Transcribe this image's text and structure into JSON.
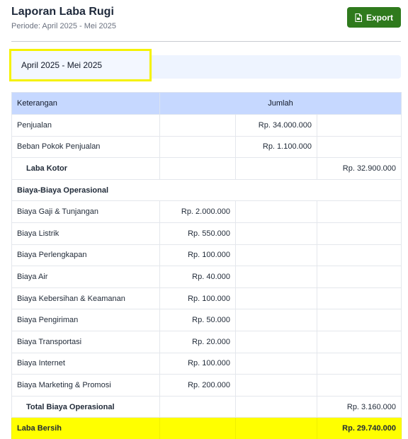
{
  "header": {
    "title": "Laporan Laba Rugi",
    "subtitle": "Periode: April 2025 - Mei 2025",
    "export_label": "Export"
  },
  "filter": {
    "period": "April 2025 - Mei 2025"
  },
  "table": {
    "col_keterangan": "Keterangan",
    "col_jumlah": "Jumlah",
    "penjualan": {
      "label": "Penjualan",
      "value": "Rp. 34.000.000"
    },
    "hpp": {
      "label": "Beban Pokok Penjualan",
      "value": "Rp. 1.100.000"
    },
    "laba_kotor": {
      "label": "Laba Kotor",
      "value": "Rp. 32.900.000"
    },
    "biaya_section": "Biaya-Biaya Operasional",
    "biaya": [
      {
        "label": "Biaya Gaji & Tunjangan",
        "value": "Rp. 2.000.000"
      },
      {
        "label": "Biaya Listrik",
        "value": "Rp. 550.000"
      },
      {
        "label": "Biaya Perlengkapan",
        "value": "Rp. 100.000"
      },
      {
        "label": "Biaya Air",
        "value": "Rp. 40.000"
      },
      {
        "label": "Biaya Kebersihan & Keamanan",
        "value": "Rp. 100.000"
      },
      {
        "label": "Biaya Pengiriman",
        "value": "Rp. 50.000"
      },
      {
        "label": "Biaya Transportasi",
        "value": "Rp. 20.000"
      },
      {
        "label": "Biaya Internet",
        "value": "Rp. 100.000"
      },
      {
        "label": "Biaya Marketing & Promosi",
        "value": "Rp. 200.000"
      }
    ],
    "total_biaya": {
      "label": "Total Biaya Operasional",
      "value": "Rp. 3.160.000"
    },
    "laba_bersih": {
      "label": "Laba Bersih",
      "value": "Rp. 29.740.000"
    }
  },
  "colors": {
    "export_button": "#2f7a1d",
    "table_header": "#c6d8ff",
    "highlight": "#ffff00"
  },
  "icons": {
    "export": "file-export-icon"
  }
}
